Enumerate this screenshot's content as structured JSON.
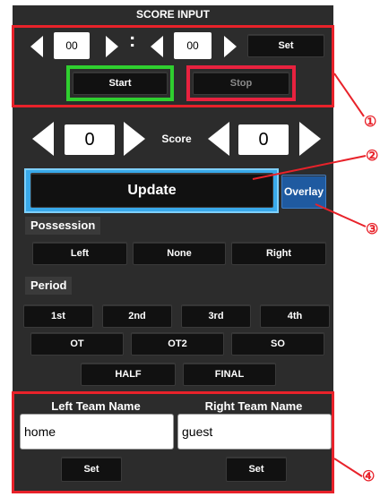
{
  "header": {
    "title": "SCORE INPUT"
  },
  "timer": {
    "minutes": "00",
    "separator": ":",
    "seconds": "00",
    "set_label": "Set",
    "start_label": "Start",
    "stop_label": "Stop"
  },
  "score": {
    "left": "0",
    "label": "Score",
    "right": "0"
  },
  "update_label": "Update",
  "overlay_label": "Overlay",
  "possession": {
    "label": "Possession",
    "options": [
      "Left",
      "None",
      "Right"
    ]
  },
  "period": {
    "label": "Period",
    "row1": [
      "1st",
      "2nd",
      "3rd",
      "4th"
    ],
    "row2": [
      "OT",
      "OT2",
      "SO"
    ],
    "row3": [
      "HALF",
      "FINAL"
    ]
  },
  "teams": {
    "left_label": "Left Team Name",
    "right_label": "Right Team Name",
    "left_value": "home",
    "right_value": "guest",
    "set_label": "Set"
  },
  "callouts": [
    "①",
    "②",
    "③",
    "④"
  ],
  "colors": {
    "accent_red": "#e8222a",
    "start_border": "#2fcf2f",
    "stop_border": "#e8223f",
    "update_glow": "#39a9ea",
    "overlay": "#1f5aa0"
  }
}
